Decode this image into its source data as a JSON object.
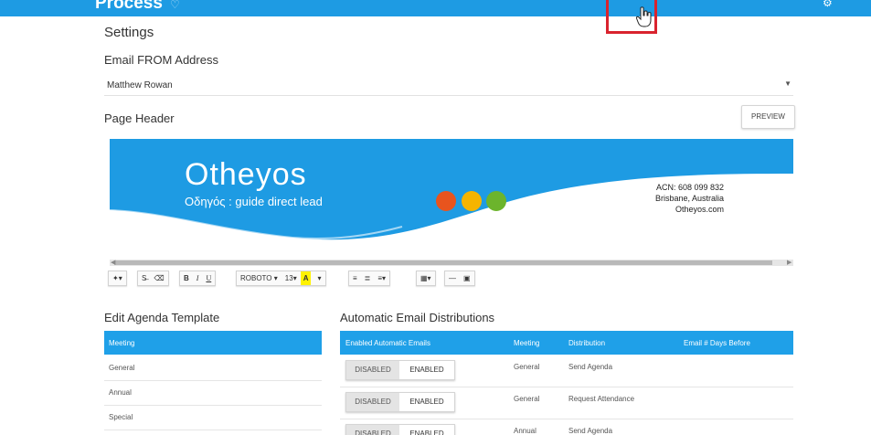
{
  "app": {
    "brand": "Process",
    "nav_blurred": [
      "",
      "",
      ""
    ]
  },
  "settings": {
    "title": "Settings",
    "email_from_label": "Email FROM Address",
    "email_from_value": "Matthew Rowan",
    "page_header_label": "Page Header",
    "preview_label": "PREVIEW"
  },
  "banner": {
    "logo": "Otheyos",
    "tagline": "Οδηγός : guide direct lead",
    "acn": "ACN: 608 099 832",
    "location": "Brisbane, Australia",
    "website": "Otheyos.com",
    "colors": {
      "blue": "#1e9be3",
      "red": "#e8541e",
      "yellow": "#f5b400",
      "green": "#6cb42c"
    }
  },
  "editor_toolbar": {
    "font": "ROBOTO",
    "size": "13",
    "bold": "B",
    "italic": "I",
    "underline": "U",
    "highlight": "A"
  },
  "agenda": {
    "title": "Edit Agenda Template",
    "header": "Meeting",
    "rows": [
      "General",
      "Annual",
      "Special"
    ]
  },
  "distributions": {
    "title": "Automatic Email Distributions",
    "columns": [
      "Enabled Automatic Emails",
      "Meeting",
      "Distribution",
      "Email # Days Before"
    ],
    "disabled_label": "DISABLED",
    "enabled_label": "ENABLED",
    "rows": [
      {
        "meeting": "General",
        "distribution": "Send Agenda"
      },
      {
        "meeting": "General",
        "distribution": "Request Attendance"
      },
      {
        "meeting": "Annual",
        "distribution": "Send Agenda"
      }
    ]
  },
  "theme": {
    "accent": "#1fa0e8",
    "highlight_box": "#d9232e"
  }
}
